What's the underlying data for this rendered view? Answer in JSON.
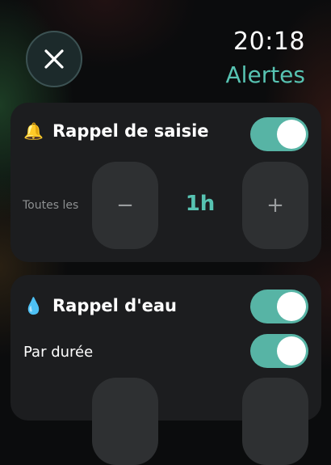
{
  "header": {
    "time": "20:18",
    "title": "Alertes",
    "close_icon": "close-icon"
  },
  "colors": {
    "accent": "#57c3b2",
    "toggle_on": "#57b4a5",
    "card_bg": "#1c1d1f",
    "stepper_bg": "#2e3032"
  },
  "input_reminder": {
    "icon": "🔔",
    "label": "Rappel de saisie",
    "enabled": true,
    "interval_label": "Toutes les",
    "decrement": "−",
    "value": "1h",
    "increment": "+"
  },
  "water_reminder": {
    "icon": "💧",
    "label": "Rappel d'eau",
    "enabled": true,
    "by_duration_label": "Par durée",
    "by_duration_enabled": true
  }
}
